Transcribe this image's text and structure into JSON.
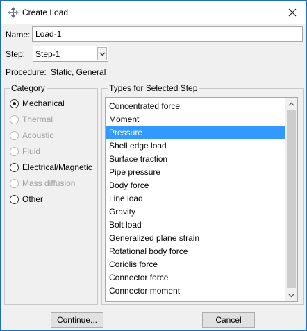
{
  "window": {
    "title": "Create Load"
  },
  "form": {
    "name_label": "Name:",
    "name_value": "Load-1",
    "step_label": "Step:",
    "step_value": "Step-1",
    "procedure_label": "Procedure:",
    "procedure_value": "Static, General"
  },
  "category": {
    "title": "Category",
    "options": [
      {
        "label": "Mechanical",
        "checked": true,
        "enabled": true
      },
      {
        "label": "Thermal",
        "checked": false,
        "enabled": false
      },
      {
        "label": "Acoustic",
        "checked": false,
        "enabled": false
      },
      {
        "label": "Fluid",
        "checked": false,
        "enabled": false
      },
      {
        "label": "Electrical/Magnetic",
        "checked": false,
        "enabled": true
      },
      {
        "label": "Mass diffusion",
        "checked": false,
        "enabled": false
      },
      {
        "label": "Other",
        "checked": false,
        "enabled": true
      }
    ]
  },
  "types": {
    "title": "Types for Selected Step",
    "selected": "Pressure",
    "items": [
      "Concentrated force",
      "Moment",
      "Pressure",
      "Shell edge load",
      "Surface traction",
      "Pipe pressure",
      "Body force",
      "Line load",
      "Gravity",
      "Bolt load",
      "Generalized plane strain",
      "Rotational body force",
      "Coriolis force",
      "Connector force",
      "Connector moment"
    ]
  },
  "buttons": {
    "continue_label": "Continue...",
    "cancel_label": "Cancel"
  },
  "colors": {
    "selection": "#3399ff",
    "window_border": "#1f6fb5",
    "disabled_text": "#a0a0a0"
  },
  "icons": {
    "app": "abaqus-app-icon",
    "close": "close-icon",
    "dropdown": "chevron-down-icon",
    "scroll_up": "chevron-up-icon",
    "scroll_down": "chevron-down-icon"
  }
}
